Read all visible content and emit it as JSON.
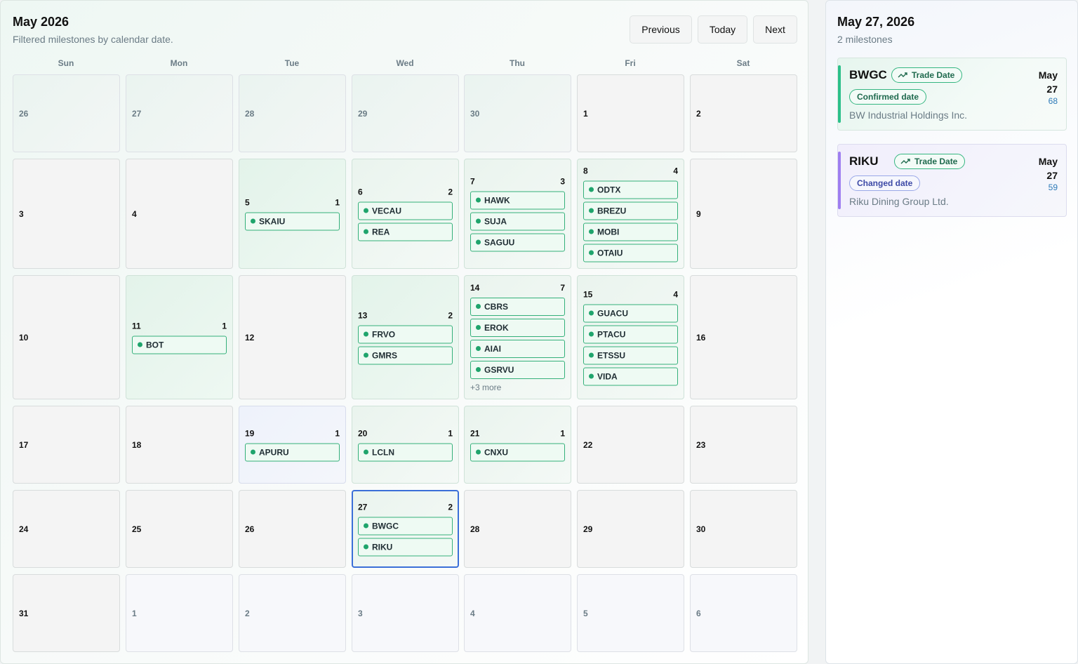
{
  "calendar": {
    "title": "May 2026",
    "subtitle": "Filtered milestones by calendar date.",
    "buttons": {
      "previous": "Previous",
      "today": "Today",
      "next": "Next"
    },
    "weekdays": [
      "Sun",
      "Mon",
      "Tue",
      "Wed",
      "Thu",
      "Fri",
      "Sat"
    ],
    "weeks": [
      [
        {
          "day": "26",
          "out": true
        },
        {
          "day": "27",
          "out": true
        },
        {
          "day": "28",
          "out": true
        },
        {
          "day": "29",
          "out": true
        },
        {
          "day": "30",
          "out": true
        },
        {
          "day": "1"
        },
        {
          "day": "2"
        }
      ],
      [
        {
          "day": "3"
        },
        {
          "day": "4"
        },
        {
          "day": "5",
          "count": "1",
          "items": [
            "SKAIU"
          ]
        },
        {
          "day": "6",
          "count": "2",
          "items": [
            "VECAU",
            "REA"
          ]
        },
        {
          "day": "7",
          "count": "3",
          "items": [
            "HAWK",
            "SUJA",
            "SAGUU"
          ]
        },
        {
          "day": "8",
          "count": "4",
          "items": [
            "ODTX",
            "BREZU",
            "MOBI",
            "OTAIU"
          ]
        },
        {
          "day": "9"
        }
      ],
      [
        {
          "day": "10"
        },
        {
          "day": "11",
          "count": "1",
          "items": [
            "BOT"
          ]
        },
        {
          "day": "12"
        },
        {
          "day": "13",
          "count": "2",
          "items": [
            "FRVO",
            "GMRS"
          ]
        },
        {
          "day": "14",
          "count": "7",
          "items": [
            "CBRS",
            "EROK",
            "AIAI",
            "GSRVU"
          ],
          "more": "+3 more"
        },
        {
          "day": "15",
          "count": "4",
          "items": [
            "GUACU",
            "PTACU",
            "ETSSU",
            "VIDA"
          ]
        },
        {
          "day": "16"
        }
      ],
      [
        {
          "day": "17"
        },
        {
          "day": "18"
        },
        {
          "day": "19",
          "count": "1",
          "items": [
            "APURU"
          ]
        },
        {
          "day": "20",
          "count": "1",
          "items": [
            "LCLN"
          ]
        },
        {
          "day": "21",
          "count": "1",
          "items": [
            "CNXU"
          ]
        },
        {
          "day": "22"
        },
        {
          "day": "23"
        }
      ],
      [
        {
          "day": "24"
        },
        {
          "day": "25"
        },
        {
          "day": "26"
        },
        {
          "day": "27",
          "count": "2",
          "items": [
            "BWGC",
            "RIKU"
          ],
          "selected": true
        },
        {
          "day": "28"
        },
        {
          "day": "29"
        },
        {
          "day": "30"
        }
      ],
      [
        {
          "day": "31"
        },
        {
          "day": "1",
          "out": true
        },
        {
          "day": "2",
          "out": true
        },
        {
          "day": "3",
          "out": true
        },
        {
          "day": "4",
          "out": true
        },
        {
          "day": "5",
          "out": true
        },
        {
          "day": "6",
          "out": true
        }
      ]
    ]
  },
  "detail": {
    "title": "May 27, 2026",
    "subtitle": "2 milestones",
    "cards": [
      {
        "ticker": "BWGC",
        "type_label": "Trade Date",
        "status": "Confirmed date",
        "company": "BW Industrial Holdings Inc.",
        "month": "May",
        "day": "27",
        "days": "68",
        "accent": "#2cc08a"
      },
      {
        "ticker": "RIKU",
        "type_label": "Trade Date",
        "status": "Changed date",
        "company": "Riku Dining Group Ltd.",
        "month": "May",
        "day": "27",
        "days": "59",
        "accent": "#9f7ff0"
      }
    ]
  }
}
